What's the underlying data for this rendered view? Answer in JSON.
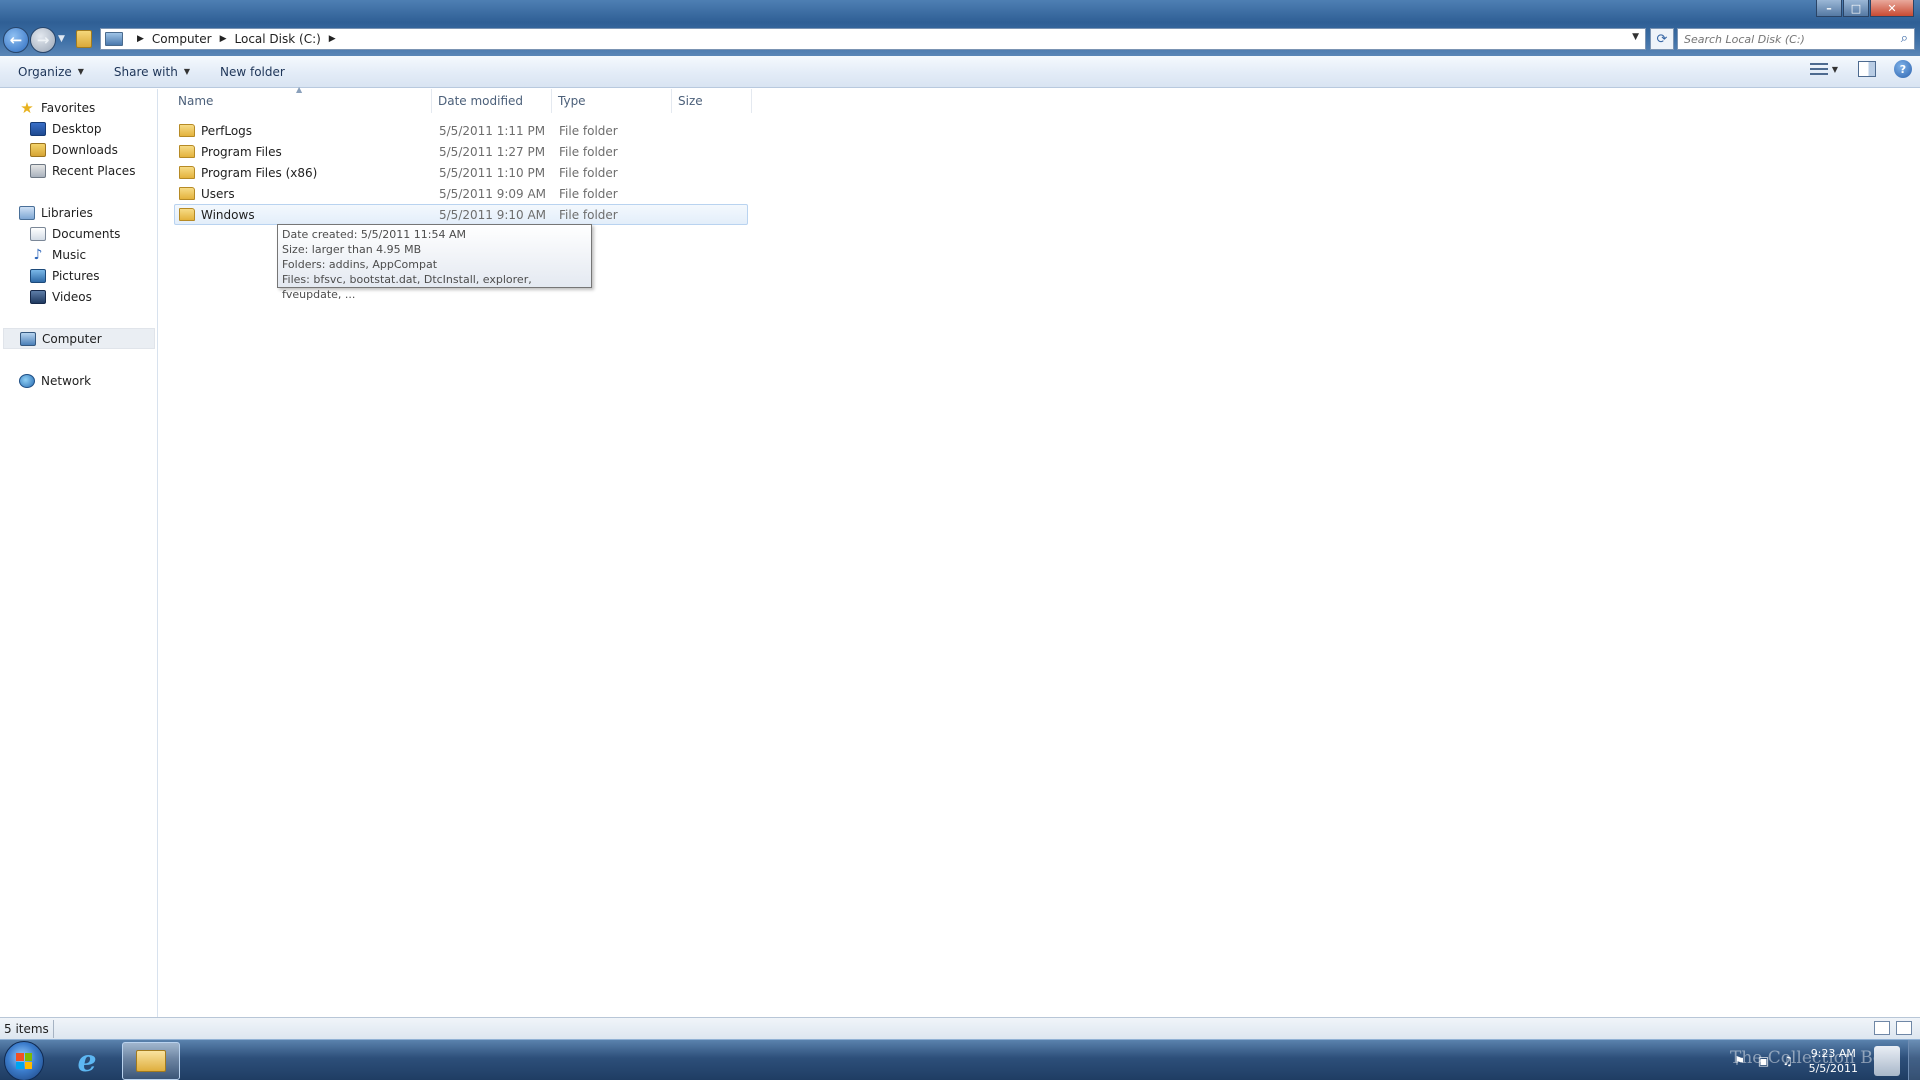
{
  "window": {
    "controls": {
      "minimize": "–",
      "maximize": "□",
      "close": "✕"
    }
  },
  "address": {
    "crumbs": [
      "Computer",
      "Local Disk (C:)"
    ],
    "search_placeholder": "Search Local Disk (C:)"
  },
  "toolbar": {
    "organize": "Organize",
    "share_with": "Share with",
    "new_folder": "New folder"
  },
  "nav": {
    "favorites": "Favorites",
    "desktop": "Desktop",
    "downloads": "Downloads",
    "recent_places": "Recent Places",
    "libraries": "Libraries",
    "documents": "Documents",
    "music": "Music",
    "pictures": "Pictures",
    "videos": "Videos",
    "computer": "Computer",
    "network": "Network"
  },
  "columns": {
    "name": "Name",
    "date": "Date modified",
    "type": "Type",
    "size": "Size"
  },
  "files": [
    {
      "name": "PerfLogs",
      "date": "5/5/2011 1:11 PM",
      "type": "File folder"
    },
    {
      "name": "Program Files",
      "date": "5/5/2011 1:27 PM",
      "type": "File folder"
    },
    {
      "name": "Program Files (x86)",
      "date": "5/5/2011 1:10 PM",
      "type": "File folder"
    },
    {
      "name": "Users",
      "date": "5/5/2011 9:09 AM",
      "type": "File folder"
    },
    {
      "name": "Windows",
      "date": "5/5/2011 9:10 AM",
      "type": "File folder"
    }
  ],
  "tooltip": {
    "line1": "Date created: 5/5/2011 11:54 AM",
    "line2": "Size: larger than 4.95 MB",
    "line3": "Folders: addins, AppCompat",
    "line4": "Files: bfsvc, bootstat.dat, DtcInstall, explorer, fveupdate, ..."
  },
  "status": {
    "count": "5 items"
  },
  "taskbar": {
    "time": "9:23 AM",
    "date": "5/5/2011",
    "watermark": "The Collection Bo"
  },
  "colors": {
    "accent": "#3565a4",
    "selection": "#e3eefa",
    "taskbar": "#2d4f7a"
  },
  "icons": {
    "back": "back-arrow-icon",
    "forward": "forward-arrow-icon",
    "search": "search-icon",
    "refresh": "refresh-icon",
    "help": "help-icon",
    "folder": "folder-icon"
  }
}
